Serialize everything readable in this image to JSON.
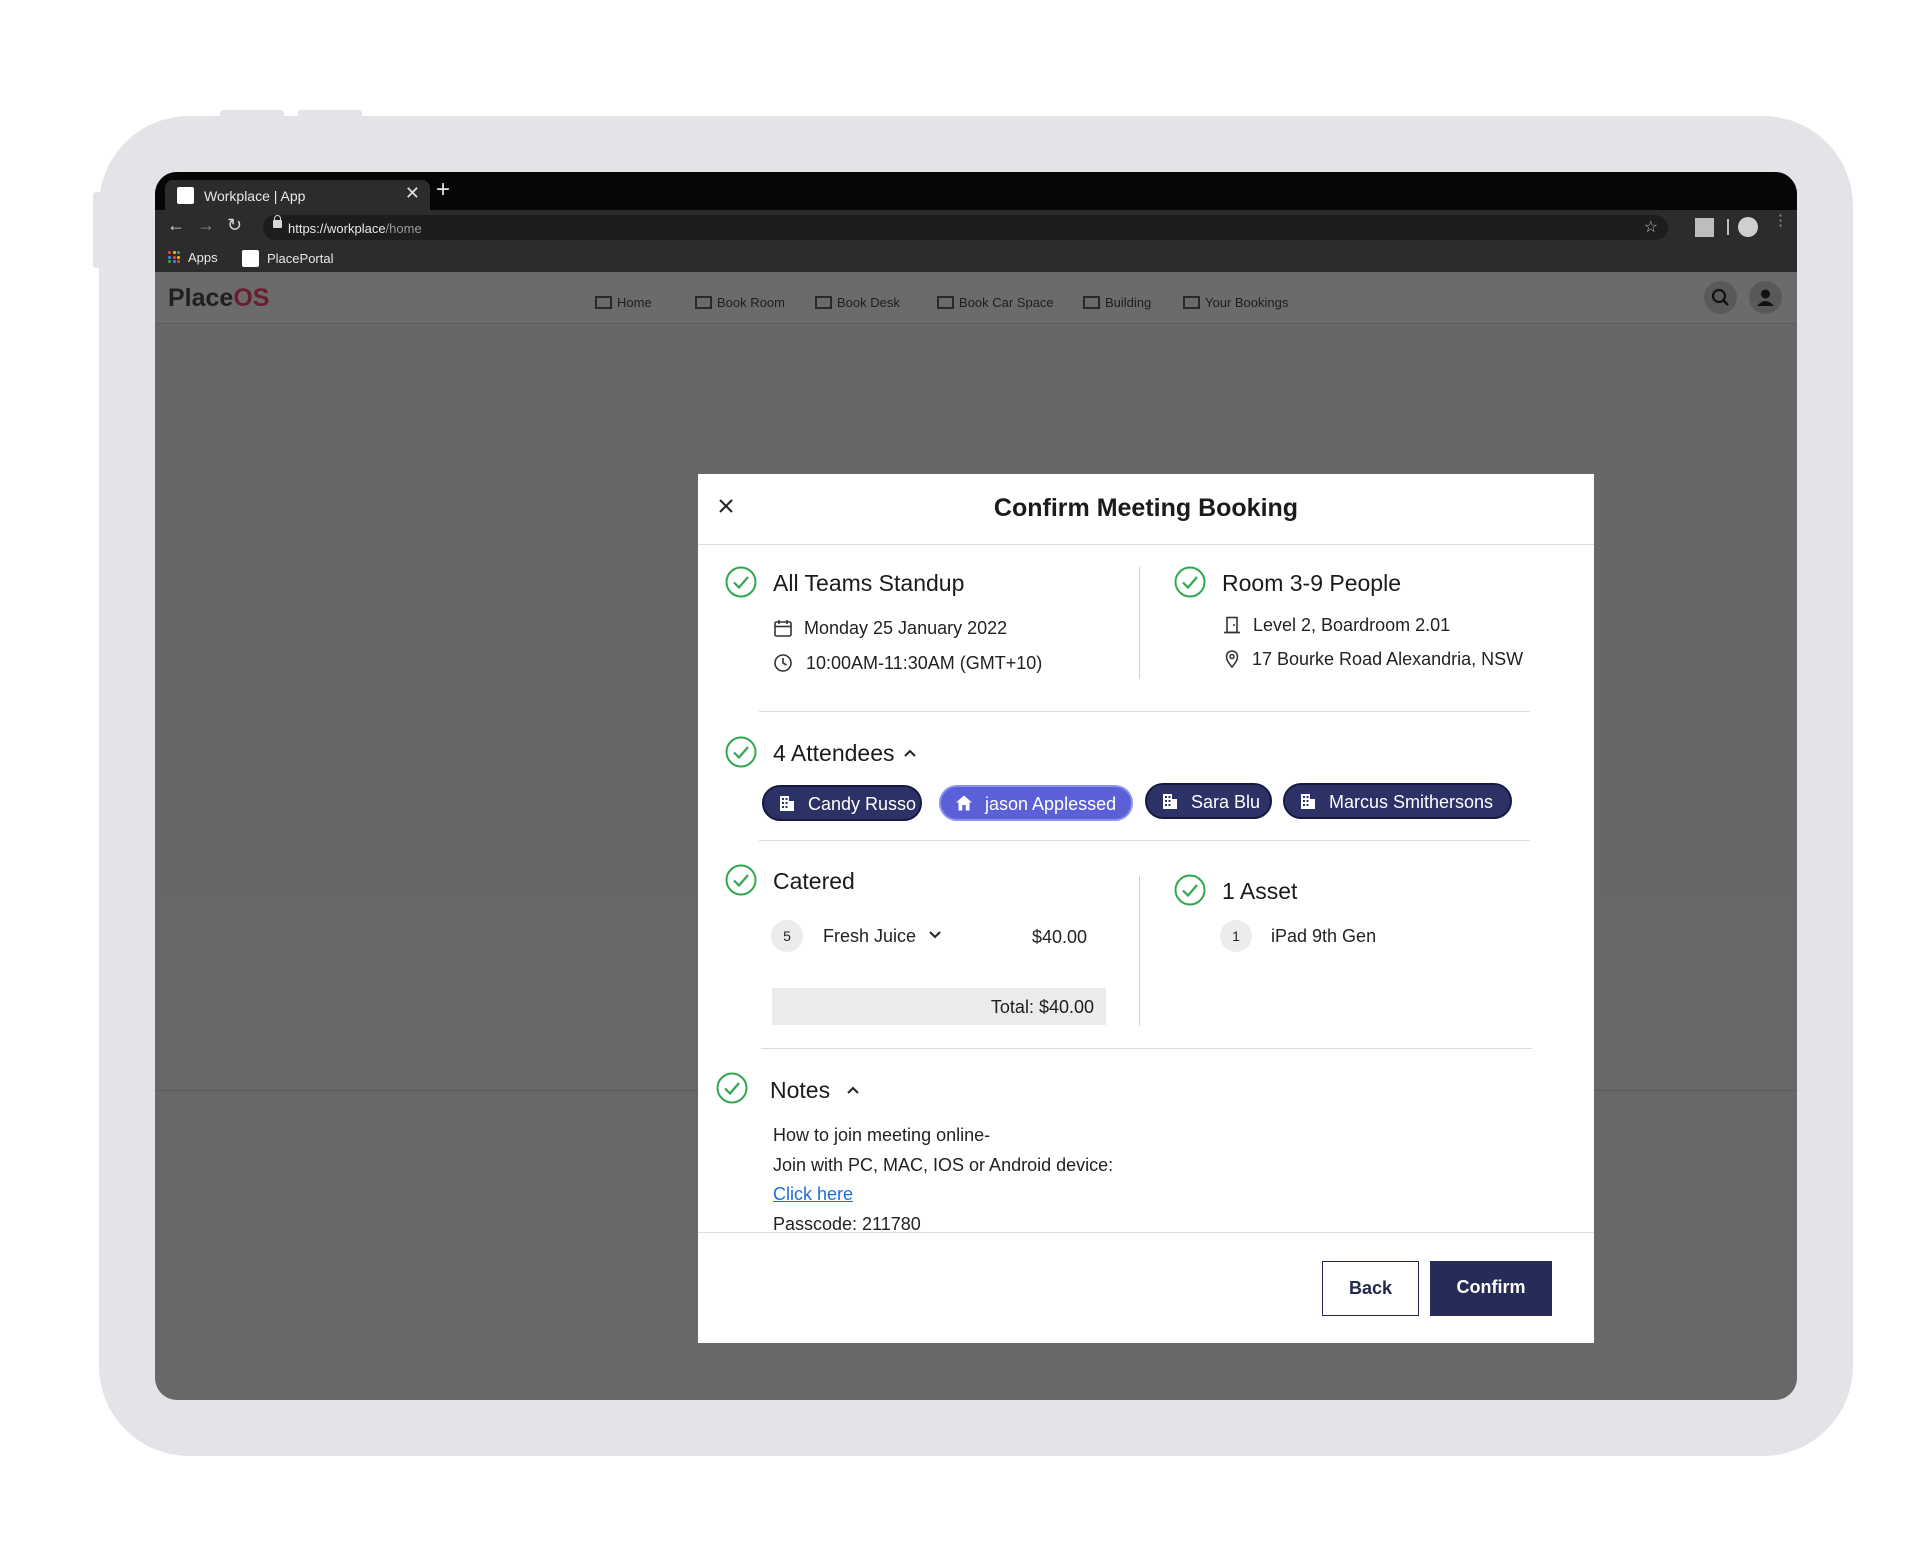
{
  "browser": {
    "tab_title": "Workplace | App",
    "tab_close": "✕",
    "new_tab": "+",
    "url_host": "https://workplace",
    "url_path": "/home",
    "bookmarks": {
      "apps_label": "Apps",
      "portal_label": "PlacePortal"
    }
  },
  "app": {
    "logo_main": "Place",
    "logo_suffix": "OS",
    "nav": [
      "Home",
      "Book Room",
      "Book Desk",
      "Book Car Space",
      "Building",
      "Your Bookings"
    ]
  },
  "dialog": {
    "title": "Confirm Meeting Booking",
    "meeting": {
      "title": "All Teams Standup",
      "date": "Monday 25 January 2022",
      "time": "10:00AM-11:30AM (GMT+10)"
    },
    "room": {
      "title": "Room 3-9 People",
      "level": "Level 2, Boardroom 2.01",
      "address": "17 Bourke Road Alexandria, NSW"
    },
    "attendees": {
      "heading": "4 Attendees",
      "list": [
        {
          "name": "Candy Russo",
          "icon": "building-icon"
        },
        {
          "name": "jason Applessed",
          "icon": "home-icon"
        },
        {
          "name": "Sara Blu",
          "icon": "building-icon"
        },
        {
          "name": "Marcus Smithersons",
          "icon": "building-icon"
        }
      ]
    },
    "catering": {
      "heading": "Catered",
      "item_qty": "5",
      "item_name": "Fresh Juice",
      "item_price": "$40.00",
      "total": "Total: $40.00"
    },
    "assets": {
      "heading": "1 Asset",
      "item_qty": "1",
      "item_name": "iPad 9th Gen"
    },
    "notes": {
      "heading": "Notes",
      "line1": "How to join meeting online-",
      "line2": "Join with PC, MAC, IOS or Android device:",
      "link": "Click here",
      "passcode": "Passcode: 211780"
    },
    "back_label": "Back",
    "confirm_label": "Confirm"
  },
  "colors": {
    "accent_navy": "#262b58",
    "chip_highlight": "#5b60d8",
    "success_green": "#2fa84f",
    "link_blue": "#1b6fd6",
    "brand_os": "#6a1d30"
  }
}
